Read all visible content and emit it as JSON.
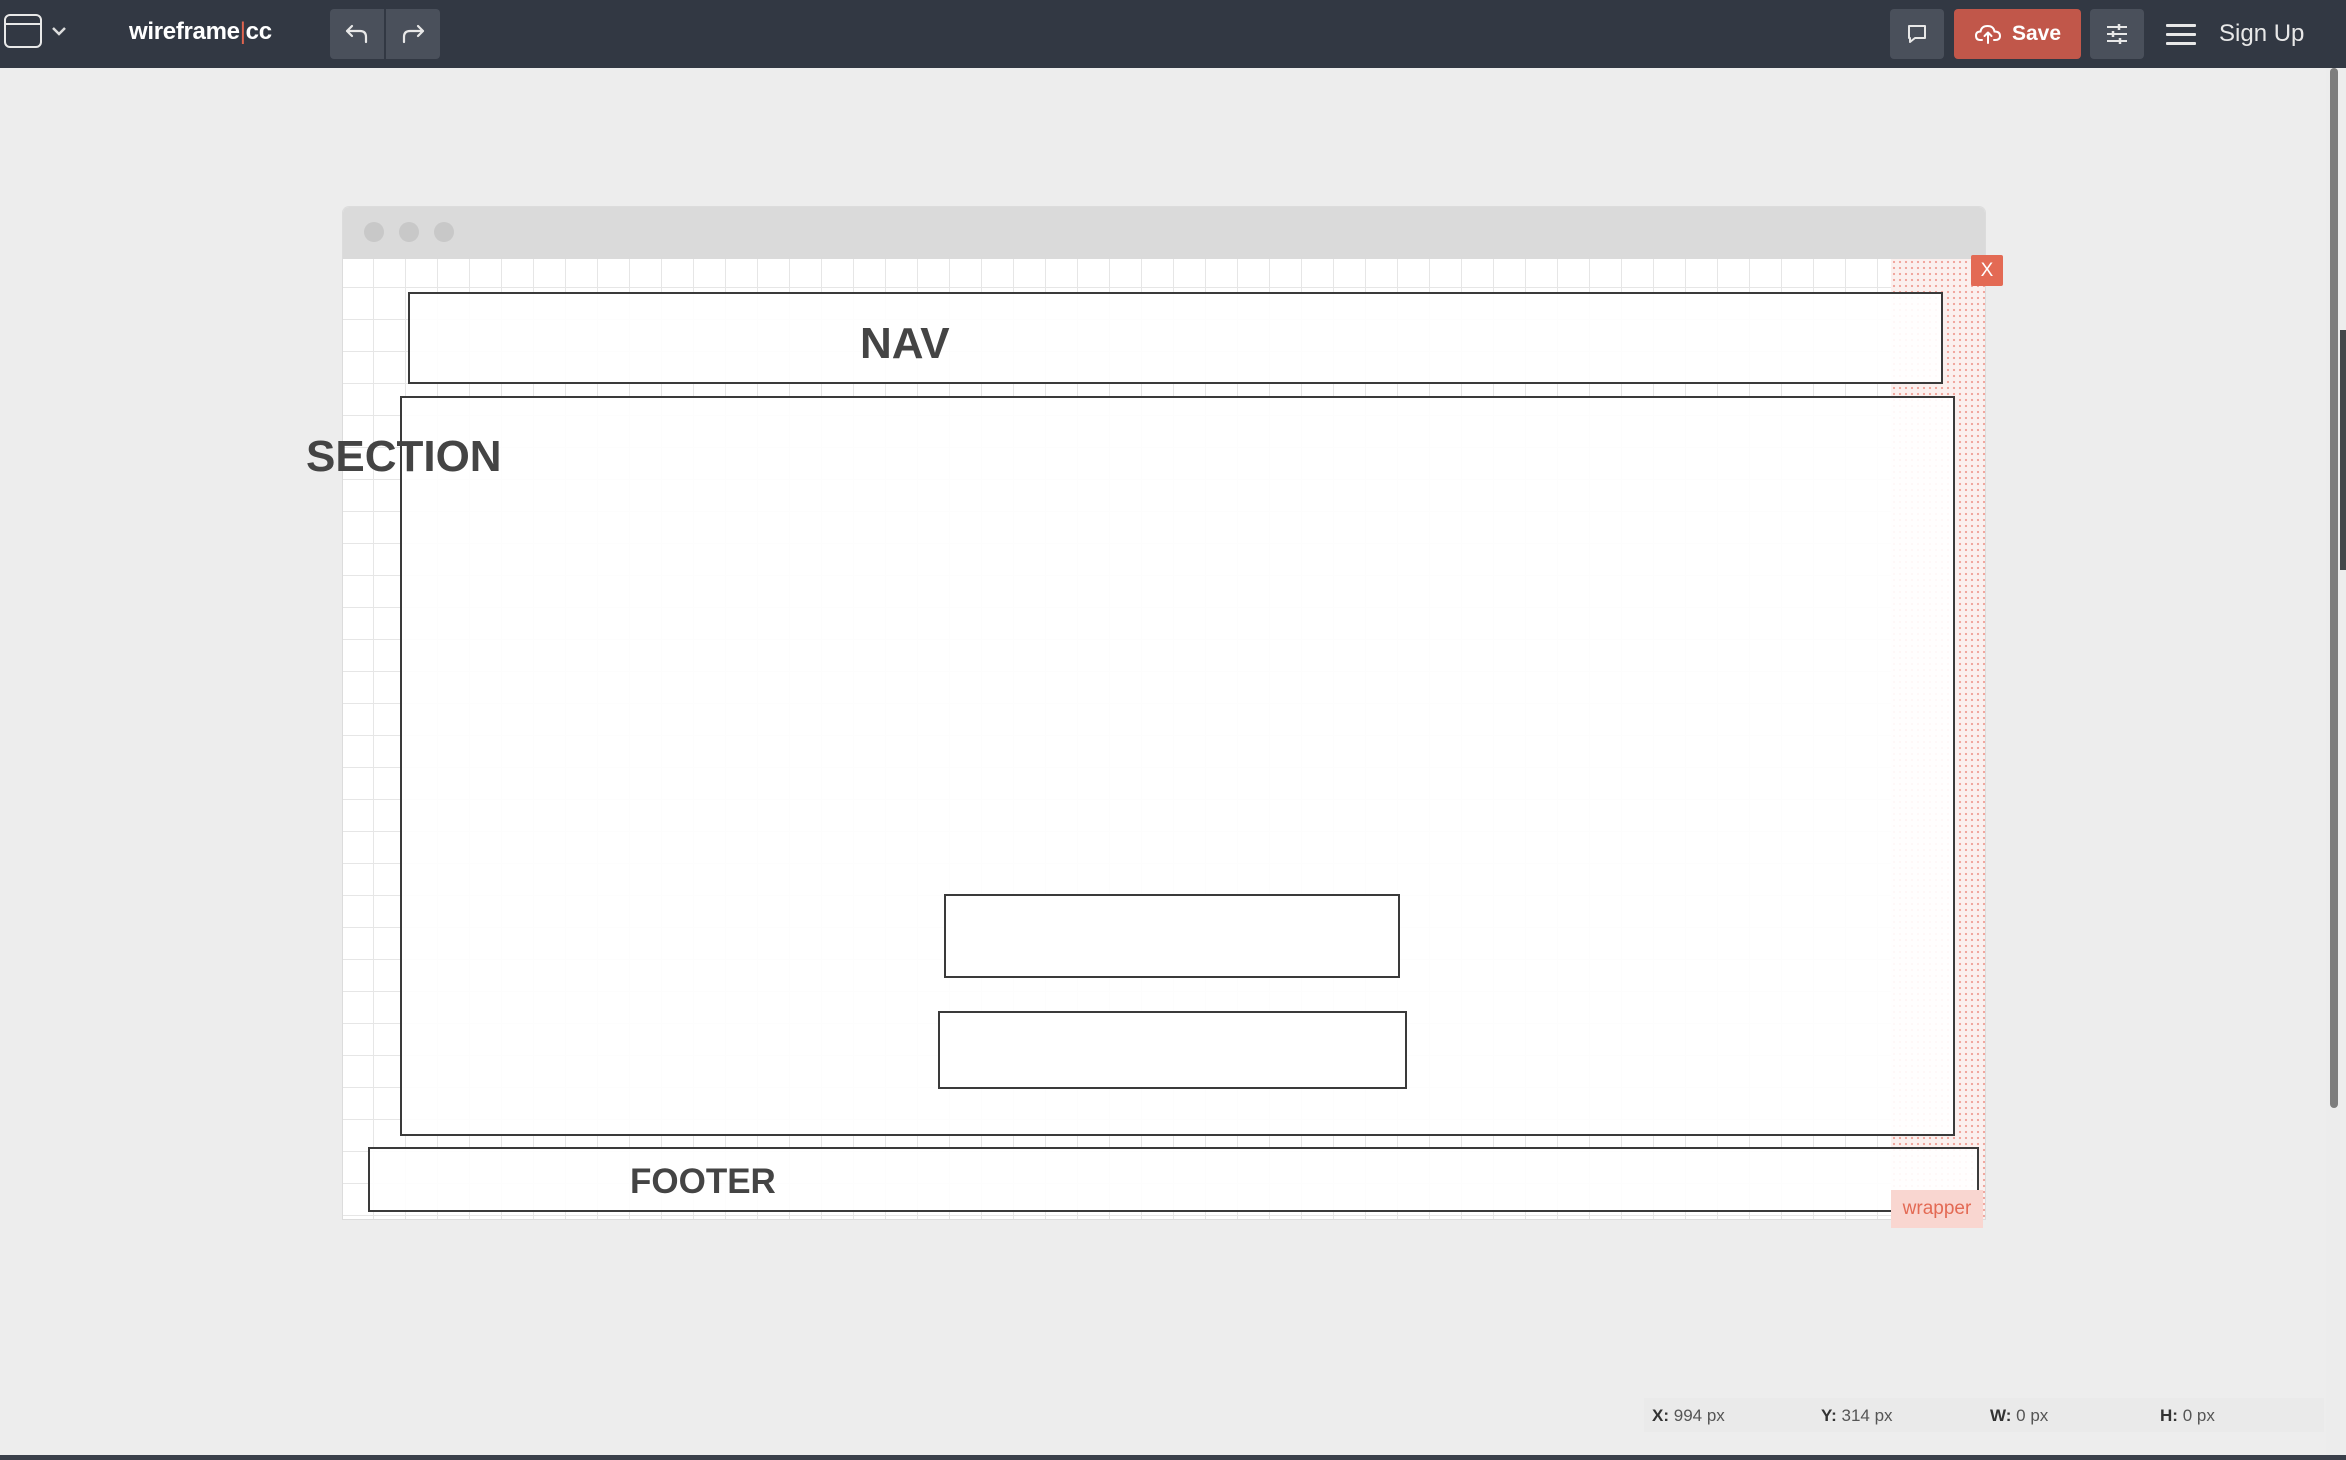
{
  "app": {
    "logo_left": "wireframe",
    "logo_sep": "|",
    "logo_right": "cc"
  },
  "toolbar": {
    "save_label": "Save",
    "signup_label": "Sign Up",
    "icons": [
      "document-icon",
      "chevron-down-icon",
      "undo-icon",
      "redo-icon",
      "comment-icon",
      "cloud-upload-icon",
      "sliders-icon",
      "menu-icon"
    ]
  },
  "canvas": {
    "nav_label": "NAV",
    "section_label": "SECTION",
    "footer_label": "FOOTER",
    "close_label": "X",
    "wrapper_label": "wrapper"
  },
  "status": {
    "x_label": "X:",
    "x_value": "994 px",
    "y_label": "Y:",
    "y_value": "314 px",
    "w_label": "W:",
    "w_value": "0 px",
    "h_label": "H:",
    "h_value": "0 px"
  },
  "colors": {
    "topbar": "#323843",
    "accent": "#c1574a",
    "selection": "#e36a54"
  }
}
